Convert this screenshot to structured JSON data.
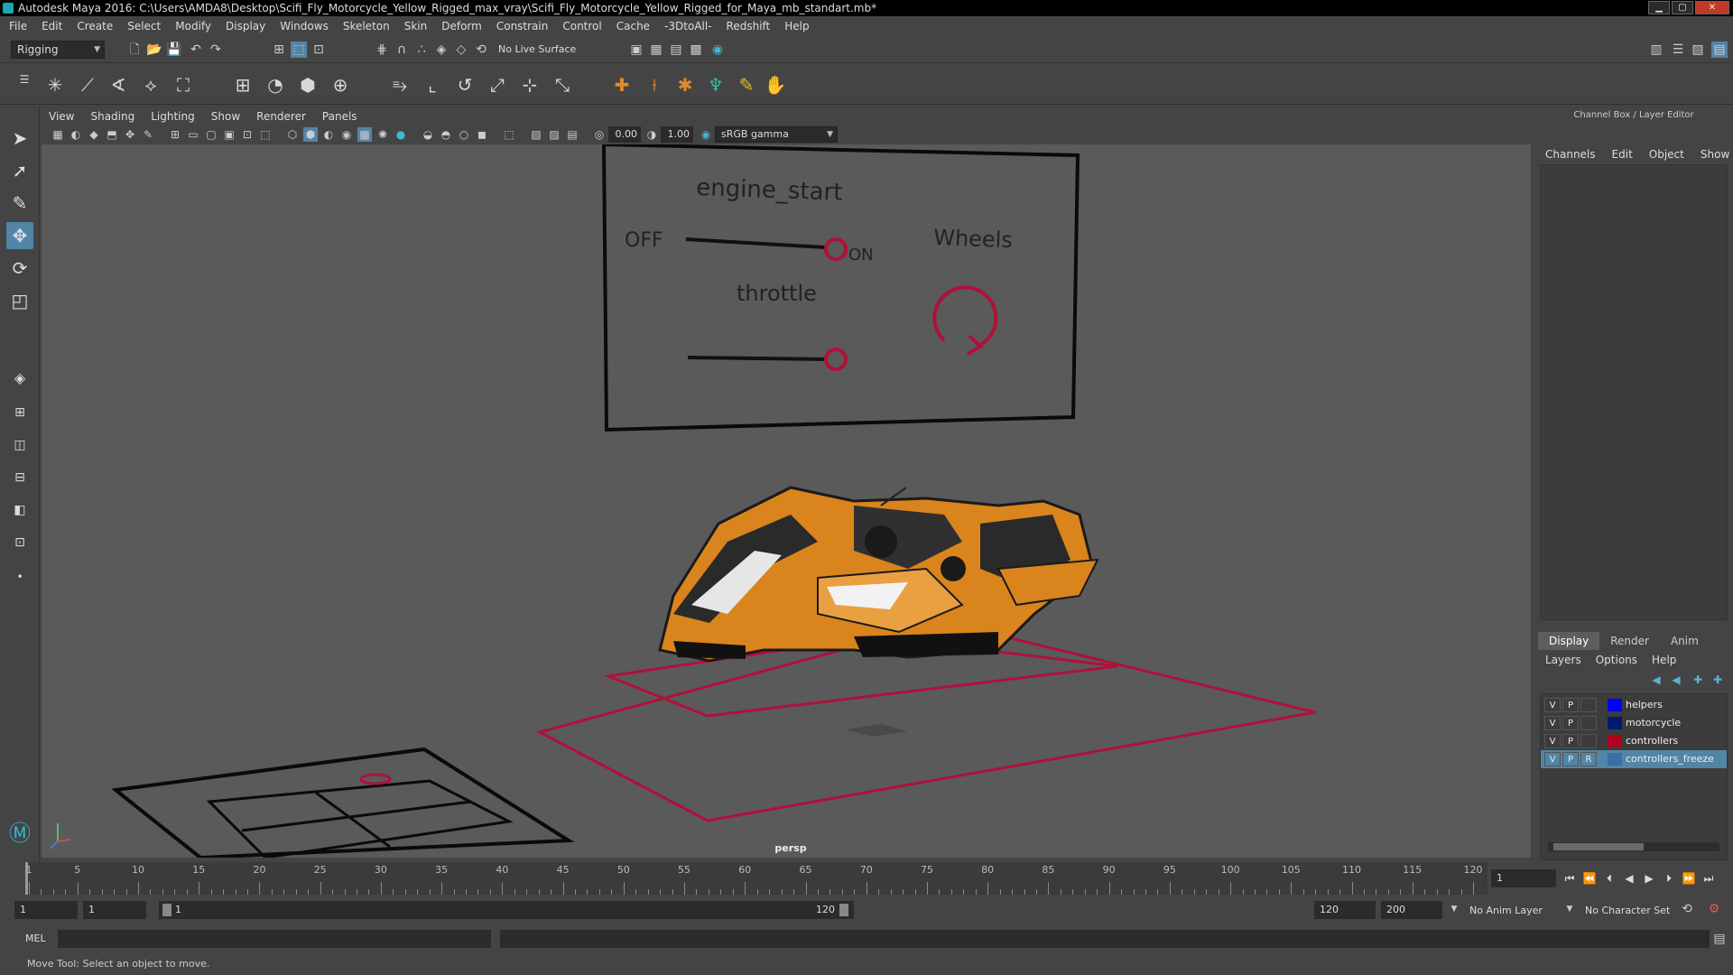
{
  "window": {
    "title": "Autodesk Maya 2016: C:\\Users\\AMDA8\\Desktop\\Scifi_Fly_Motorcycle_Yellow_Rigged_max_vray\\Scifi_Fly_Motorcycle_Yellow_Rigged_for_Maya_mb_standart.mb*",
    "minimize": "▁",
    "maximize": "▢",
    "close": "✕"
  },
  "menubar": [
    "File",
    "Edit",
    "Create",
    "Select",
    "Modify",
    "Display",
    "Windows",
    "Skeleton",
    "Skin",
    "Deform",
    "Constrain",
    "Control",
    "Cache",
    "-3DtoAll-",
    "Redshift",
    "Help"
  ],
  "statusline": {
    "menuset": "Rigging",
    "live_surface": "No Live Surface"
  },
  "viewport": {
    "menu": [
      "View",
      "Shading",
      "Lighting",
      "Show",
      "Renderer",
      "Panels"
    ],
    "exposure": "0.00",
    "gamma": "1.00",
    "color_space": "sRGB gamma",
    "camera_label": "persp"
  },
  "control_panel": {
    "engine_label": "engine_start",
    "off_label": "OFF",
    "on_label": "ON",
    "wheels_label": "Wheels",
    "throttle_label": "throttle"
  },
  "colors": {
    "controller_red": "#b0103a",
    "selection_blue": "#5285a6",
    "viewport_bg": "#5a5a5a"
  },
  "channelbox": {
    "title": "Channel Box / Layer Editor",
    "menu": [
      "Channels",
      "Edit",
      "Object",
      "Show"
    ]
  },
  "layer_editor": {
    "tabs": [
      "Display",
      "Render",
      "Anim"
    ],
    "active_tab": "Display",
    "menu": [
      "Layers",
      "Options",
      "Help"
    ],
    "layers": [
      {
        "v": "V",
        "p": "P",
        "r": "",
        "color": "#0000ff",
        "name": "helpers",
        "selected": false
      },
      {
        "v": "V",
        "p": "P",
        "r": "",
        "color": "#001a6e",
        "name": "motorcycle",
        "selected": false
      },
      {
        "v": "V",
        "p": "P",
        "r": "",
        "color": "#b00020",
        "name": "controllers",
        "selected": false
      },
      {
        "v": "V",
        "p": "P",
        "r": "R",
        "color": "#3a6ea5",
        "name": "controllers_freeze",
        "selected": true
      }
    ]
  },
  "timeline": {
    "ticks": [
      "1",
      "5",
      "10",
      "15",
      "20",
      "25",
      "30",
      "35",
      "40",
      "45",
      "50",
      "55",
      "60",
      "65",
      "70",
      "75",
      "80",
      "85",
      "90",
      "95",
      "100",
      "105",
      "110",
      "115",
      "120"
    ],
    "current_frame": "1"
  },
  "range": {
    "start": "1",
    "playback_start": "1",
    "slider_start": "1",
    "slider_end": "120",
    "playback_end": "120",
    "end": "200",
    "anim_layer": "No Anim Layer",
    "character_set": "No Character Set"
  },
  "cmdline": {
    "lang": "MEL"
  },
  "helpline": "Move Tool: Select an object to move."
}
